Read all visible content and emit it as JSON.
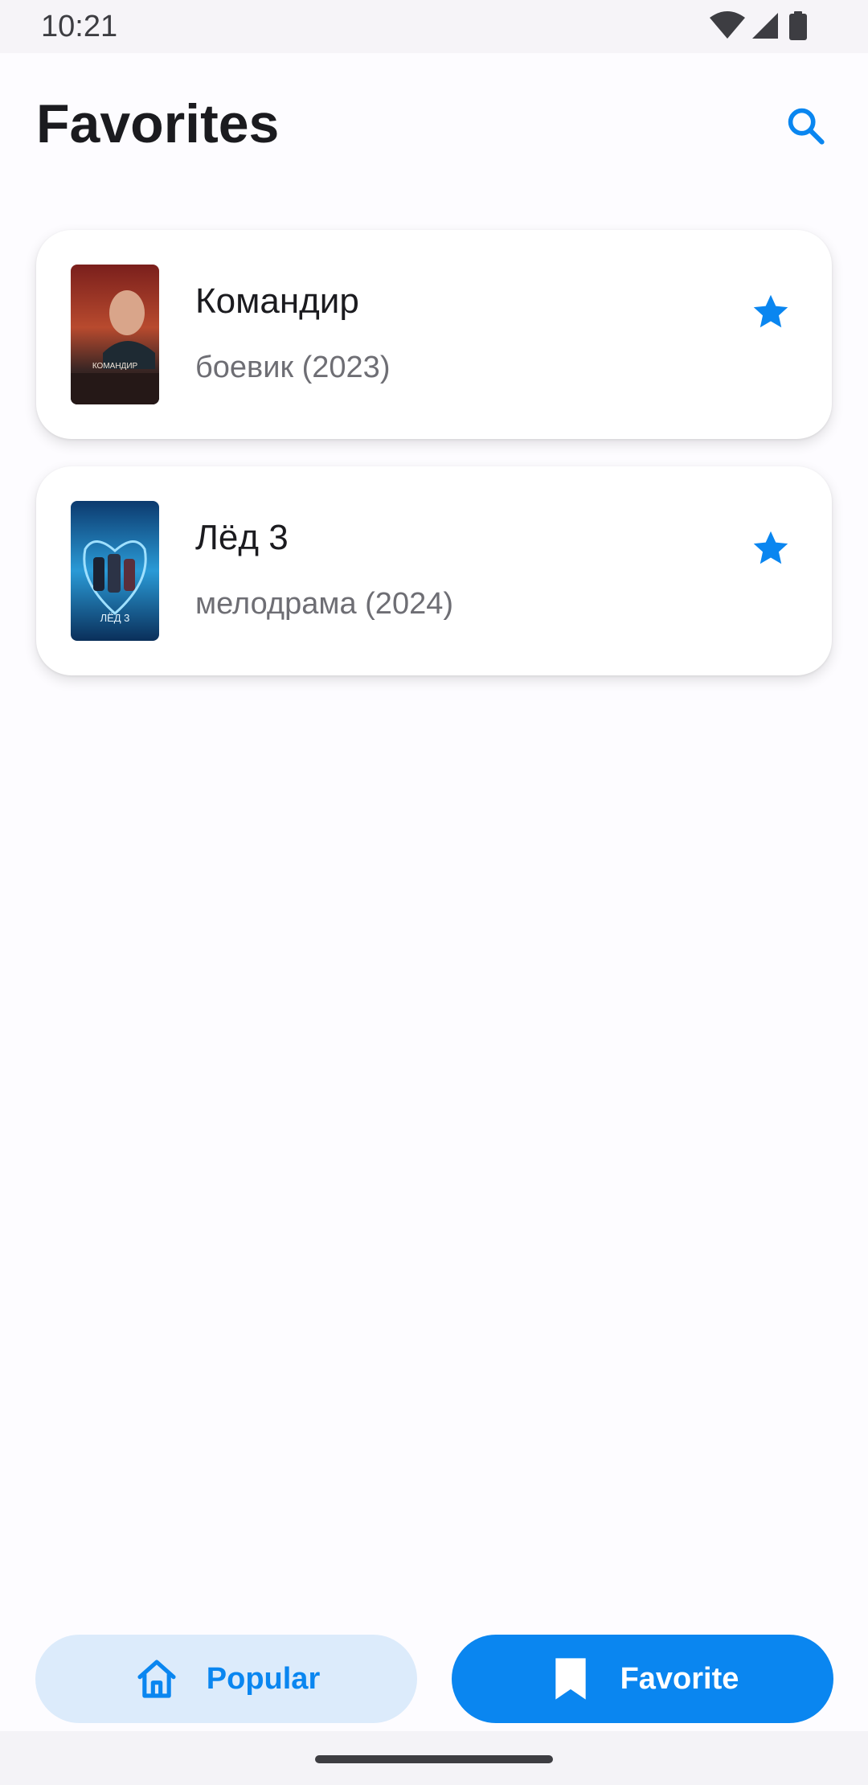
{
  "status_bar": {
    "time": "10:21",
    "icons": [
      "wifi-icon",
      "signal-icon",
      "battery-icon"
    ]
  },
  "header": {
    "title": "Favorites",
    "search_icon": "search-icon"
  },
  "favorites": [
    {
      "title": "Командир",
      "subtitle": "боевик (2023)",
      "poster_text": "КОМАНДИР",
      "favorite_icon": "star-filled-icon"
    },
    {
      "title": "Лёд 3",
      "subtitle": "мелодрама (2024)",
      "poster_text": "ЛЁД 3",
      "favorite_icon": "star-filled-icon"
    }
  ],
  "bottom_nav": {
    "popular_label": "Popular",
    "popular_icon": "home-icon",
    "favorite_label": "Favorite",
    "favorite_icon": "bookmark-icon",
    "selected": "Favorite"
  },
  "colors": {
    "accent": "#0a86f0",
    "accent_light": "#dcebfb",
    "background": "#fdfcff",
    "card": "#ffffff",
    "subtitle_text": "#6e6e74"
  }
}
